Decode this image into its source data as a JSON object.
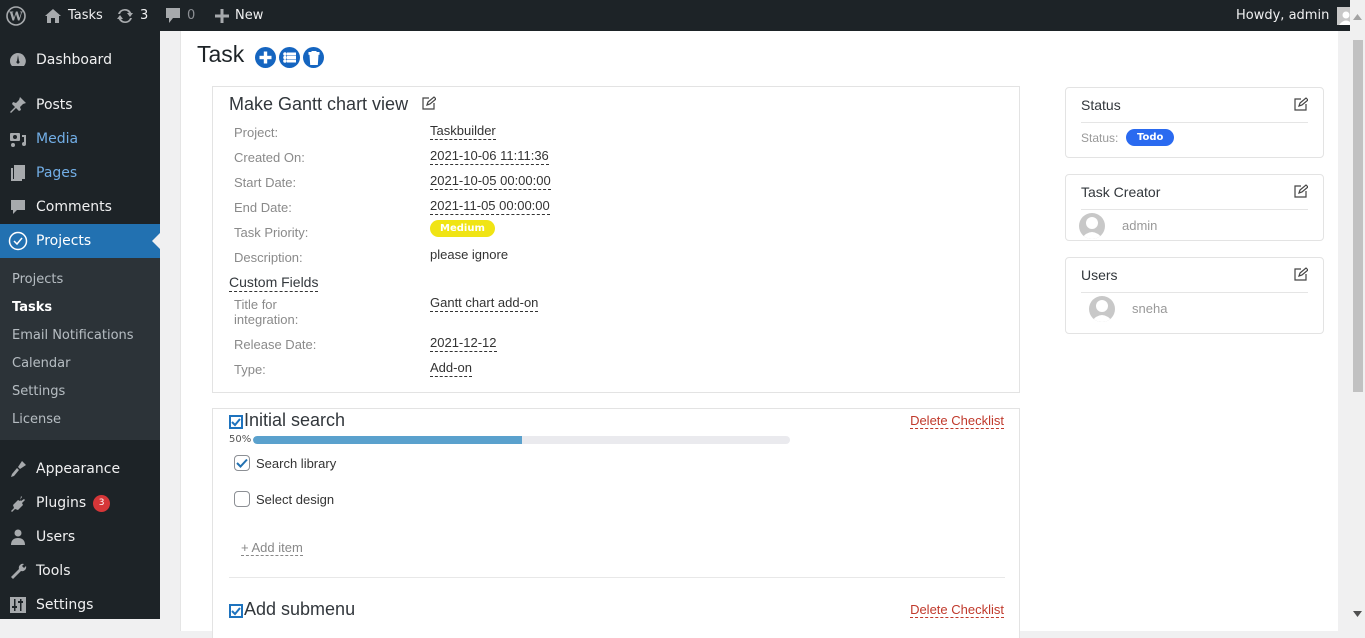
{
  "adminbar": {
    "site_name": "Tasks",
    "updates_count": "3",
    "comments_count": "0",
    "new_label": "New",
    "greeting": "Howdy, admin"
  },
  "sidebar": {
    "items": [
      {
        "label": "Dashboard",
        "icon": "dashboard-icon"
      },
      {
        "label": "Posts",
        "icon": "pin-icon"
      },
      {
        "label": "Media",
        "icon": "media-icon"
      },
      {
        "label": "Pages",
        "icon": "pages-icon"
      },
      {
        "label": "Comments",
        "icon": "comment-icon"
      },
      {
        "label": "Projects",
        "icon": "check-circle-icon"
      },
      {
        "label": "Appearance",
        "icon": "brush-icon"
      },
      {
        "label": "Plugins",
        "icon": "plugin-icon",
        "badge": "3"
      },
      {
        "label": "Users",
        "icon": "user-icon"
      },
      {
        "label": "Tools",
        "icon": "wrench-icon"
      },
      {
        "label": "Settings",
        "icon": "sliders-icon"
      }
    ],
    "submenu": [
      "Projects",
      "Tasks",
      "Email Notifications",
      "Calendar",
      "Settings",
      "License"
    ]
  },
  "page": {
    "title": "Task",
    "actions": [
      "add-icon",
      "list-icon",
      "trash-icon"
    ]
  },
  "task": {
    "name": "Make Gantt chart view",
    "fields": [
      {
        "label": "Project:",
        "value": "Taskbuilder"
      },
      {
        "label": "Created On:",
        "value": "2021-10-06 11:11:36"
      },
      {
        "label": "Start Date:",
        "value": "2021-10-05 00:00:00"
      },
      {
        "label": "End Date:",
        "value": "2021-11-05 00:00:00"
      },
      {
        "label": "Task Priority:",
        "value": "Medium"
      },
      {
        "label": "Description:",
        "value": "please ignore"
      }
    ],
    "priority_color": "#f0e414",
    "custom_fields_title": "Custom Fields",
    "custom_fields": [
      {
        "label": "Title for integration:",
        "value": "Gantt chart add-on"
      },
      {
        "label": "Release Date:",
        "value": "2021-12-12"
      },
      {
        "label": "Type:",
        "value": "Add-on"
      }
    ]
  },
  "checklists": [
    {
      "title": "Initial search",
      "delete_label": "Delete Checklist",
      "progress_label": "50%",
      "progress": 0.5,
      "items": [
        {
          "label": "Search library",
          "checked": true
        },
        {
          "label": "Select design",
          "checked": false
        }
      ],
      "add_item_label": "+ Add item"
    },
    {
      "title": "Add submenu",
      "delete_label": "Delete Checklist"
    }
  ],
  "status_card": {
    "title": "Status",
    "label": "Status:",
    "value": "Todo",
    "color": "#2a6af0"
  },
  "creator_card": {
    "title": "Task Creator",
    "user": "admin"
  },
  "users_card": {
    "title": "Users",
    "user": "sneha"
  }
}
